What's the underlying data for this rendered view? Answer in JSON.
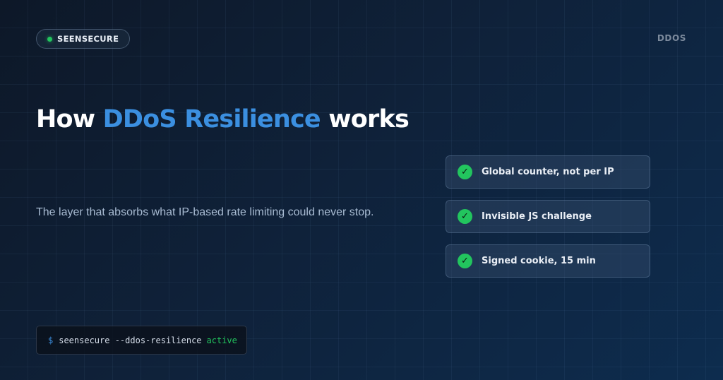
{
  "brand": {
    "name": "SEENSECURE",
    "status_color": "#22c55e",
    "status_icon": "status-dot"
  },
  "top_tag": "DDOS",
  "headline": {
    "prefix": "How ",
    "highlight": "DDoS Resilience",
    "suffix": " works",
    "highlight_color": "#3b8fe0"
  },
  "subtitle": "The layer that absorbs what IP-based rate limiting could never stop.",
  "features": [
    {
      "label": "Global counter, not per IP",
      "icon": "check-icon"
    },
    {
      "label": "Invisible JS challenge",
      "icon": "check-icon"
    },
    {
      "label": "Signed cookie, 15 min",
      "icon": "check-icon"
    }
  ],
  "terminal": {
    "prompt": "$",
    "command": "seensecure --ddos-resilience",
    "status": "active"
  },
  "colors": {
    "accent": "#3b8fe0",
    "success": "#22c55e",
    "background": "#0f2139"
  }
}
